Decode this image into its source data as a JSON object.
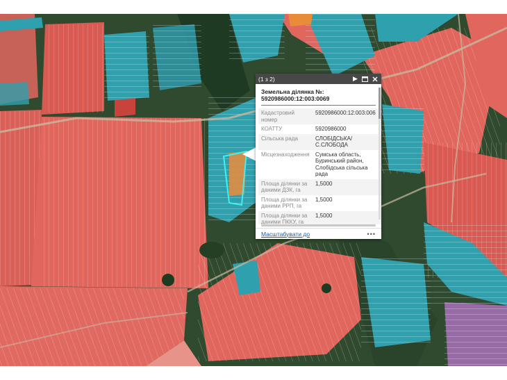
{
  "popup": {
    "pager": "(1 з 2)",
    "icons": {
      "next": "play-icon",
      "maximize": "maximize-icon",
      "close": "close-icon"
    },
    "title": "Земельна ділянка №: 5920986000:12:003:0069",
    "fields": [
      {
        "label": "Кадастровий номер",
        "value": "5920986000:12:003:006"
      },
      {
        "label": "КОАТТУ",
        "value": "5920986000"
      },
      {
        "label": "Сільська рада",
        "value": "СЛОБІДСЬКА/ С.СЛОБОДА"
      },
      {
        "label": "Місцезнаходження",
        "value": "Сумська область, Буринський район, Слобідська сільська рада"
      },
      {
        "label": "Площа ділянки за даними ДЗК, га",
        "value": "1,5000"
      },
      {
        "label": "Площа ділянки за даними РРП, га",
        "value": "1,5000"
      },
      {
        "label": "Площа ділянки за даними ПККУ, га",
        "value": "1,5000"
      }
    ],
    "zoom_link": "Масштабувати до",
    "more": "•••"
  },
  "colors": {
    "parcel_red": "#e0665e",
    "parcel_teal": "#2fa0ae",
    "parcel_orange": "#e98c3a",
    "parcel_purple": "#9a6aa6",
    "vegetation": "#2f4a2e",
    "selection": "#3ff0f0",
    "popup_header": "#484848",
    "link": "#1a5aa6"
  }
}
